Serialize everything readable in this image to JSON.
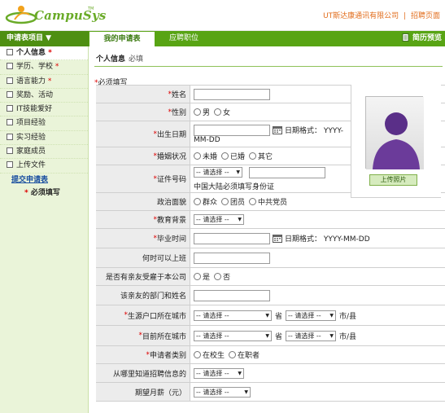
{
  "header": {
    "logo_text": "CampuSys",
    "logo_tm": "TM",
    "company": "UT斯达康通讯有限公司",
    "recruit_home": "招聘页面"
  },
  "nav": {
    "menu_title": "申请表项目 ▼",
    "tabs": [
      {
        "label": "我的申请表"
      },
      {
        "label": "应聘职位"
      }
    ],
    "preview_label": "简历预览"
  },
  "sidebar": {
    "items": [
      {
        "label": "个人信息",
        "required": "*"
      },
      {
        "label": "学历、学校",
        "required": "*"
      },
      {
        "label": "语言能力",
        "required": "*"
      },
      {
        "label": "奖励、活动",
        "required": ""
      },
      {
        "label": "IT技能爱好",
        "required": ""
      },
      {
        "label": "项目经验",
        "required": ""
      },
      {
        "label": "实习经验",
        "required": ""
      },
      {
        "label": "家庭成员",
        "required": ""
      },
      {
        "label": "上传文件",
        "required": ""
      }
    ],
    "submit_label": "提交申请表",
    "must_note": "* 必须填写"
  },
  "main": {
    "section_title": "个人信息",
    "section_note": "必填",
    "must_note": "必须填写",
    "photo_upload_label": "上传照片",
    "select_placeholder": "-- 请选择 --",
    "date_hint": "日期格式： YYYY-MM-DD",
    "date_hint_wrapped": "日期格式： YYYY-",
    "date_hint_tail": "MM-DD",
    "province_label": "省",
    "city_label": "市/县",
    "id_note": "中国大陆必须填写身份证",
    "rows": [
      {
        "label": "姓名",
        "required": true
      },
      {
        "label": "性别",
        "required": true,
        "options": [
          "男",
          "女"
        ]
      },
      {
        "label": "出生日期",
        "required": true
      },
      {
        "label": "婚姻状况",
        "required": true,
        "options": [
          "未婚",
          "已婚",
          "其它"
        ]
      },
      {
        "label": "证件号码",
        "required": true
      },
      {
        "label": "政治面貌",
        "required": false,
        "options": [
          "群众",
          "团员",
          "中共党员"
        ]
      },
      {
        "label": "教育背景",
        "required": true
      },
      {
        "label": "毕业时间",
        "required": true
      },
      {
        "label": "何时可以上班",
        "required": false
      },
      {
        "label": "是否有亲友受雇于本公司",
        "required": false,
        "options": [
          "是",
          "否"
        ]
      },
      {
        "label": "该亲友的部门和姓名",
        "required": false
      },
      {
        "label": "生源户口所在城市",
        "required": true
      },
      {
        "label": "目前所在城市",
        "required": true
      },
      {
        "label": "申请者类别",
        "required": true,
        "options": [
          "在校生",
          "在职者"
        ]
      },
      {
        "label": "从哪里知道招聘信息的",
        "required": false
      },
      {
        "label": "期望月薪（元）",
        "required": false
      }
    ]
  },
  "colors": {
    "brand_green": "#58a414",
    "sidebar_bg": "#eaf4d9",
    "link_orange": "#e26d1c",
    "required_red": "#d00000"
  }
}
